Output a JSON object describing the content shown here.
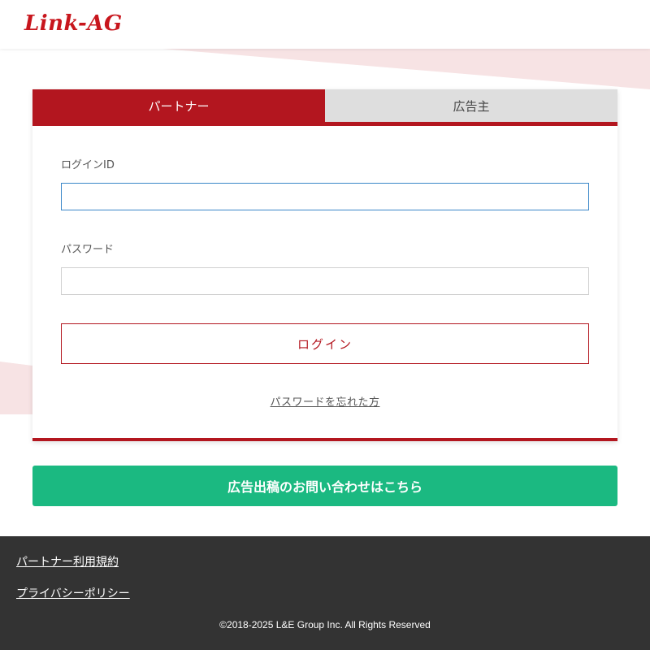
{
  "header": {
    "logo_text": "Link-AG"
  },
  "tabs": [
    {
      "label": "パートナー",
      "active": true
    },
    {
      "label": "広告主",
      "active": false
    }
  ],
  "form": {
    "login_id_label": "ログインID",
    "login_id_value": "",
    "password_label": "パスワード",
    "password_value": "",
    "login_button": "ログイン",
    "forgot_password": "パスワードを忘れた方"
  },
  "contact_button": "広告出稿のお問い合わせはこちら",
  "footer": {
    "links": [
      "パートナー利用規約",
      "プライバシーポリシー"
    ],
    "copyright": "©2018-2025 L&E Group Inc. All Rights Reserved"
  },
  "colors": {
    "brand_red": "#b3161f",
    "accent_green": "#1bb981",
    "footer_bg": "#333333"
  }
}
